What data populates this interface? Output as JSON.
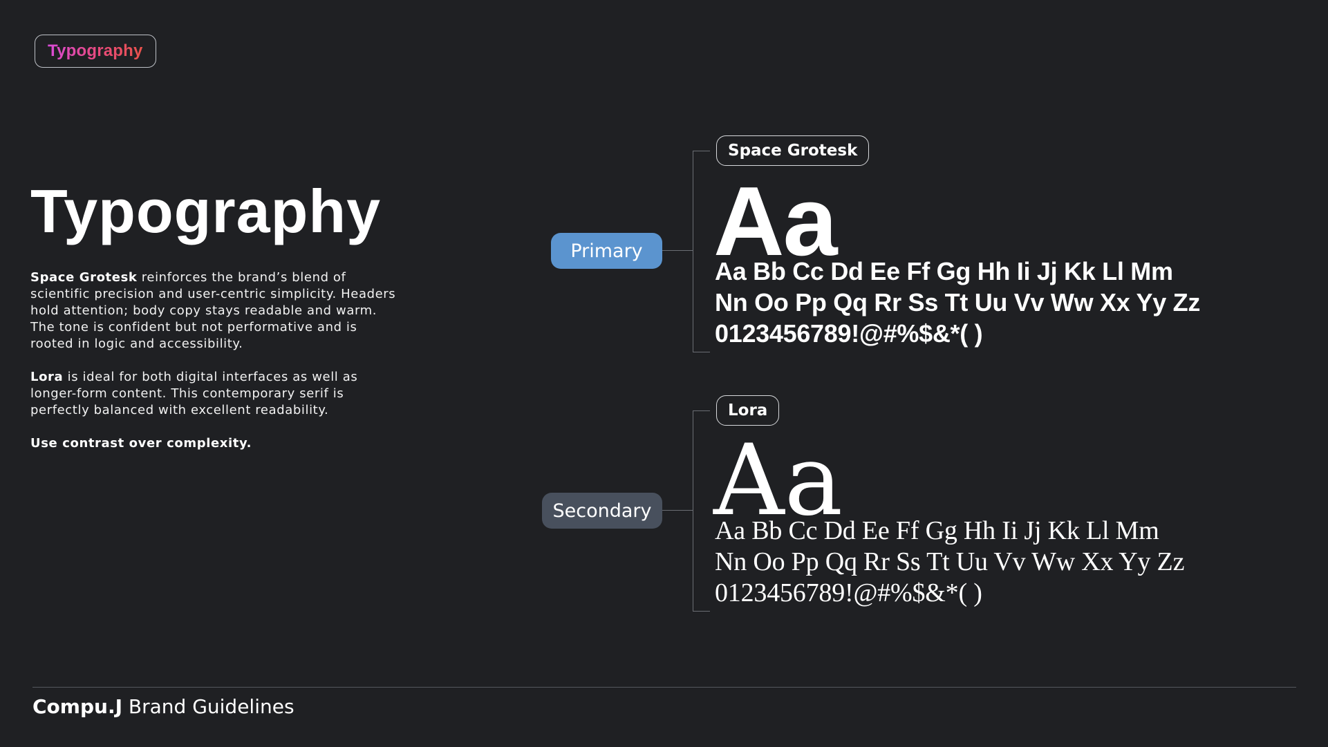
{
  "tag": {
    "label": "Typography"
  },
  "title": "Typography",
  "description": {
    "p1_bold": "Space Grotesk",
    "p1_text": " reinforces the brand’s blend of scientific precision and user-centric simplicity. Headers hold attention; body copy stays readable and warm. The tone is confident but not performative and is rooted in logic and accessibility.",
    "p2_bold": "Lora",
    "p2_text": " is ideal for both digital interfaces as well as longer-form content. This contemporary serif is perfectly balanced with excellent readability.",
    "p3_bold": "Use contrast over complexity."
  },
  "primary": {
    "role": "Primary",
    "font_name": "Space Grotesk",
    "sample": "Aa",
    "lines": [
      "Aa Bb Cc Dd Ee Ff Gg Hh Ii Jj Kk Ll Mm",
      "Nn Oo Pp Qq Rr Ss Tt Uu Vv Ww Xx Yy Zz",
      "0123456789!@#%$&*( )"
    ],
    "role_color": "#5b94cf"
  },
  "secondary": {
    "role": "Secondary",
    "font_name": "Lora",
    "sample": "Aa",
    "lines": [
      "Aa Bb Cc Dd Ee Ff Gg Hh Ii Jj Kk Ll Mm",
      "Nn Oo Pp Qq Rr Ss Tt Uu Vv Ww Xx Yy Zz",
      "0123456789!@#%$&*( )"
    ],
    "role_color": "#48505d"
  },
  "footer": {
    "brand": "Compu.J",
    "text": " Brand Guidelines"
  },
  "colors": {
    "background": "#1f2023",
    "tag_gradient": [
      "#d94bd8",
      "#e94a7a",
      "#e8524a"
    ]
  }
}
